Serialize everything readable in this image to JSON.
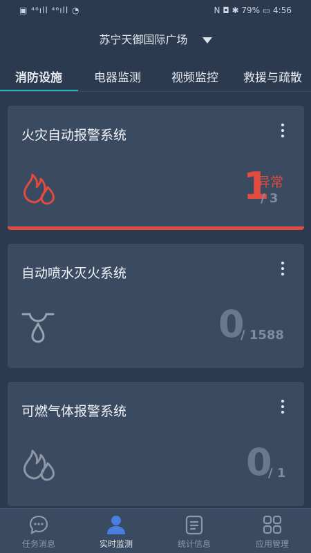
{
  "status_bar": {
    "left": "▣ ⁴⁶ıll ⁴⁶ıll ◔",
    "right": "N ◘ ✱ 79% ▭ 4:56"
  },
  "site": {
    "name": "苏宁天御国际广场"
  },
  "tabs": [
    {
      "label": "消防设施",
      "active": true
    },
    {
      "label": "电器监测",
      "active": false
    },
    {
      "label": "视频监控",
      "active": false
    },
    {
      "label": "救援与疏散",
      "active": false
    }
  ],
  "cards": [
    {
      "title": "火灾自动报警系统",
      "count": "1",
      "count_label": "异常",
      "total": "/ 3",
      "status_color": "#e24b3f",
      "icon": "fire-icon"
    },
    {
      "title": "自动喷水灭火系统",
      "count": "0",
      "total": "/ 1588",
      "icon": "sprinkler-icon"
    },
    {
      "title": "可燃气体报警系统",
      "count": "0",
      "total": "/ 1",
      "icon": "gas-flame-icon"
    }
  ],
  "bottom_nav": [
    {
      "label": "任务消息",
      "icon": "chat-icon",
      "active": false
    },
    {
      "label": "实时监测",
      "icon": "user-icon",
      "active": true
    },
    {
      "label": "统计信息",
      "icon": "document-icon",
      "active": false
    },
    {
      "label": "应用管理",
      "icon": "grid-icon",
      "active": false
    }
  ],
  "colors": {
    "accent": "#26b7b0",
    "alarm": "#e24b3f",
    "background": "#2c3a4f",
    "card": "#3a4a61"
  }
}
